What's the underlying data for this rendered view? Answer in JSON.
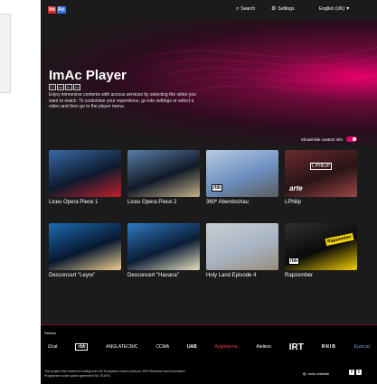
{
  "header": {
    "logo_im": "Im",
    "logo_ac": "Ac",
    "search_label": "Search",
    "settings_label": "Settings",
    "language": "English (UK)"
  },
  "hero": {
    "title": "ImAc Player",
    "access_icons": [
      "ST",
      "AD",
      "SL",
      "AS"
    ],
    "description": "Enjoy immersive contents with access services by selecting the video you want to watch. To customise your experience, go into settings or select a video and then go to the player menu."
  },
  "toggle": {
    "label": "Show/Hide content info",
    "on": true
  },
  "videos": [
    {
      "title": "Liceu Opera Piece 1",
      "colors": [
        "#0d1a2e",
        "#3a6aa8",
        "#c0202a"
      ]
    },
    {
      "title": "Liceu Opera Piece 2",
      "colors": [
        "#111a28",
        "#5a7fa8",
        "#c7b08a"
      ]
    },
    {
      "title": "360º Abendschau",
      "colors": [
        "#6c8fc0",
        "#b8cbe2",
        "#5c5c5c"
      ],
      "badge": "rbb"
    },
    {
      "title": "LPhilip",
      "colors": [
        "#2a1416",
        "#6a2a2e",
        "#9a4646"
      ],
      "badge_text": "L PHILIP",
      "brand": "arte"
    },
    {
      "title": "Desconcert \"Leyre\"",
      "colors": [
        "#071830",
        "#1e6bb0",
        "#f0d090"
      ]
    },
    {
      "title": "Desconcert \"Havana\"",
      "colors": [
        "#0a1d36",
        "#2f7ac0",
        "#e8e0c0"
      ]
    },
    {
      "title": "Holy Land Episode 4",
      "colors": [
        "#a8b4c4",
        "#c9ced4",
        "#9a8c7a"
      ]
    },
    {
      "title": "Rapzember",
      "colors": [
        "#0a0a0a",
        "#303030",
        "#f2d000"
      ],
      "badge": "rbb",
      "stamp": "Rapzember"
    }
  ],
  "footer": {
    "partners_label": "Partners",
    "partners": [
      "i2cat",
      "rbb",
      "ANGLATECNIC",
      "CCMA",
      "UAB",
      "Anglatecnic",
      "Ateliers",
      "IRT",
      "RNIB",
      "Eurecat"
    ],
    "funding_text": "This project has received funding from the European Union's Horizon 2020 Research and Innovation Programme under grant agreement No 761974.",
    "website_label": "ImAc website",
    "social": [
      "f",
      "t"
    ]
  },
  "colors": {
    "accent": "#e6006a",
    "background": "#1b1b1b",
    "footer": "#000000"
  }
}
